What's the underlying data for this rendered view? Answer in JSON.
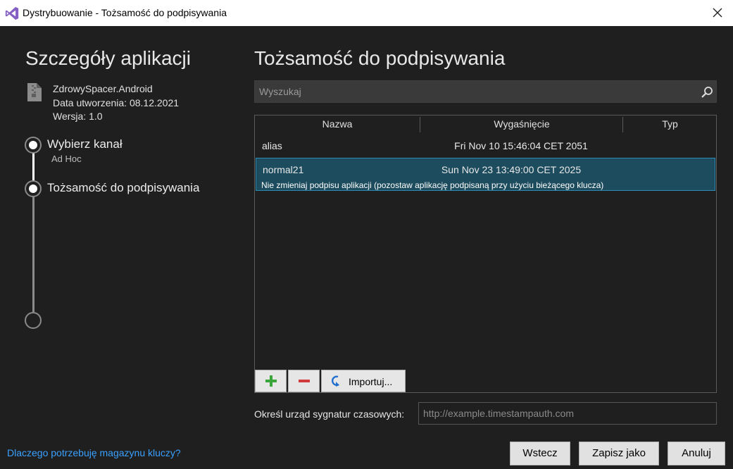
{
  "window": {
    "title": "Dystrybuowanie - Tożsamość do podpisywania",
    "icon": "visual-studio-logo",
    "close_icon": "close-icon"
  },
  "left": {
    "heading": "Szczegóły aplikacji",
    "app_name": "ZdrowySpacer.Android",
    "created": "Data utworzenia: 08.12.2021",
    "version": "Wersja: 1.0",
    "steps": [
      {
        "label": "Wybierz kanał",
        "sub": "Ad Hoc",
        "state": "completed"
      },
      {
        "label": "Tożsamość do podpisywania",
        "state": "current"
      },
      {
        "label": "",
        "state": "pending"
      }
    ],
    "help_link": "Dlaczego potrzebuję magazynu kluczy?"
  },
  "right": {
    "heading": "Tożsamość do podpisywania",
    "search": {
      "placeholder": "Wyszukaj",
      "value": ""
    },
    "table": {
      "columns": [
        "Nazwa",
        "Wygaśnięcie",
        "Typ"
      ],
      "rows": [
        {
          "name": "alias",
          "expiration": "Fri Nov 10 15:46:04 CET 2051",
          "type": "",
          "selected": false
        },
        {
          "name": "normal21",
          "expiration": "Sun Nov 23 13:49:00 CET 2025",
          "type": "",
          "selected": true,
          "note": "Nie zmieniaj podpisu aplikacji (pozostaw aplikację podpisaną przy użyciu bieżącego klucza)"
        }
      ]
    },
    "toolbar": {
      "add_icon": "plus-icon",
      "remove_icon": "minus-icon",
      "import_label": "Importuj..."
    },
    "timestamp": {
      "label": "Określ urząd sygnatur czasowych:",
      "placeholder": "http://example.timestampauth.com",
      "value": ""
    }
  },
  "footer": {
    "back": "Wstecz",
    "save_as": "Zapisz jako",
    "cancel": "Anuluj"
  },
  "colors": {
    "background": "#1f1f1f",
    "selection": "#1c4c5e",
    "selection_border": "#2d8bb3",
    "link": "#3aa0ff",
    "add_green": "#3aa53a",
    "remove_red": "#d03a3a",
    "vs_purple": "#865fc5"
  }
}
